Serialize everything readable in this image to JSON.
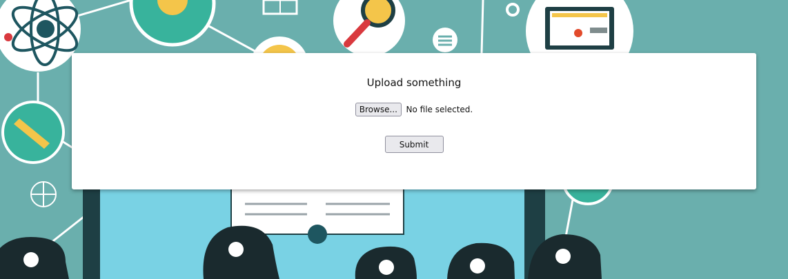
{
  "upload_form": {
    "title": "Upload something",
    "browse_label": "Browse...",
    "file_status": "No file selected.",
    "submit_label": "Submit"
  },
  "colors": {
    "background": "#6aafad",
    "card": "#ffffff",
    "button": "#e9e9ed"
  },
  "background_icons": [
    "atom-icon",
    "flask-icon",
    "book-icon",
    "magnifier-icon",
    "gear-icon",
    "chat-icon",
    "laptop-icon",
    "mail-icon",
    "pencil-icon",
    "basketball-icon",
    "microscope-icon",
    "open-book-icon",
    "students-silhouette"
  ]
}
